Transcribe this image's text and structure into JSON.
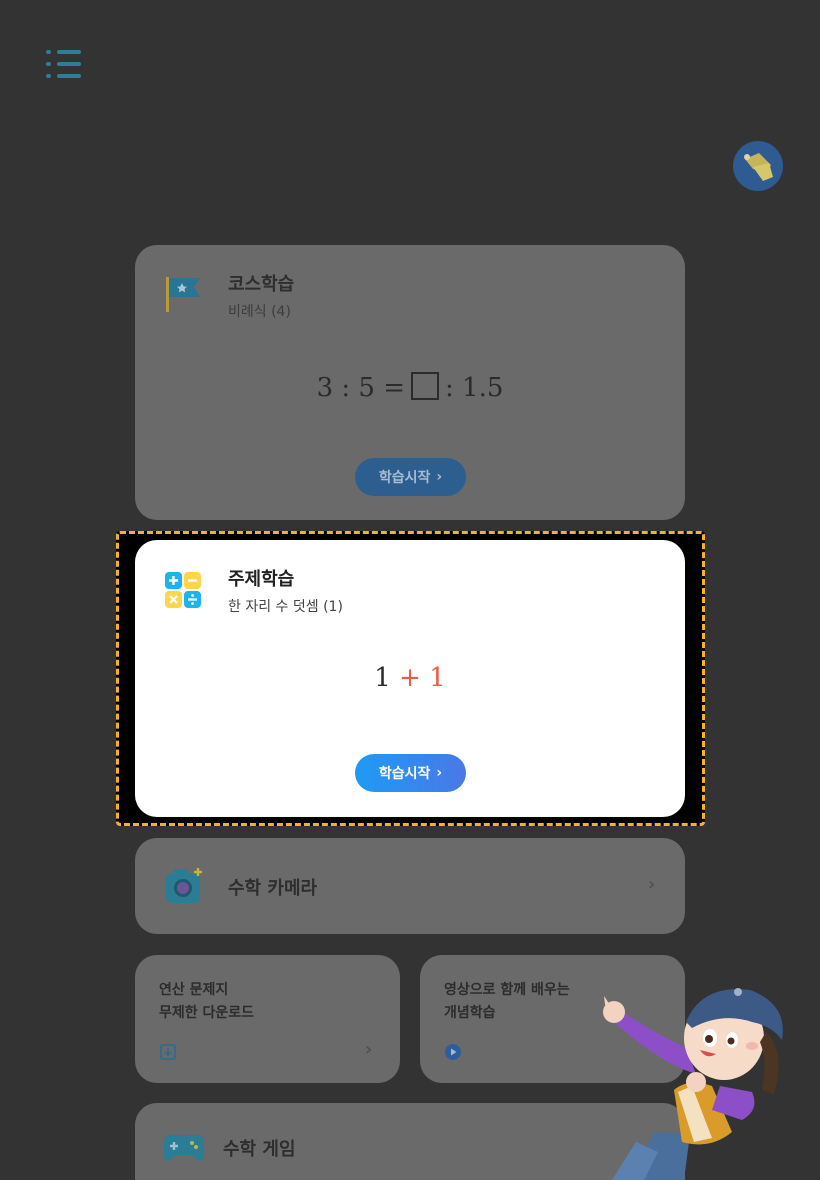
{
  "header": {
    "menu_icon": "menu-list-icon",
    "avatar_icon": "character-avatar-icon"
  },
  "course_card": {
    "icon": "flag-icon",
    "title": "코스학습",
    "subtitle": "비례식 (4)",
    "formula_left": "3 : 5 =",
    "formula_right": ": 1.5",
    "button_label": "학습시작"
  },
  "topic_card": {
    "icon": "calculator-symbols-icon",
    "title": "주제학습",
    "subtitle": "한 자리 수 덧셈 (1)",
    "formula_a": "1",
    "formula_op": "+",
    "formula_b": "1",
    "button_label": "학습시작"
  },
  "camera_row": {
    "icon": "camera-icon",
    "title": "수학 카메라"
  },
  "worksheet_card": {
    "text": "연산 문제지\n무제한 다운로드",
    "icon": "download-icon"
  },
  "video_card": {
    "text": "영상으로 함께 배우는\n개념학습",
    "icon": "play-icon"
  },
  "game_row": {
    "icon": "gamepad-icon",
    "title": "수학 게임"
  },
  "colors": {
    "background": "#333333",
    "accent_blue": "#1e9bf5",
    "highlight_orange": "#f2b32b",
    "operator_red": "#ef5a45"
  }
}
